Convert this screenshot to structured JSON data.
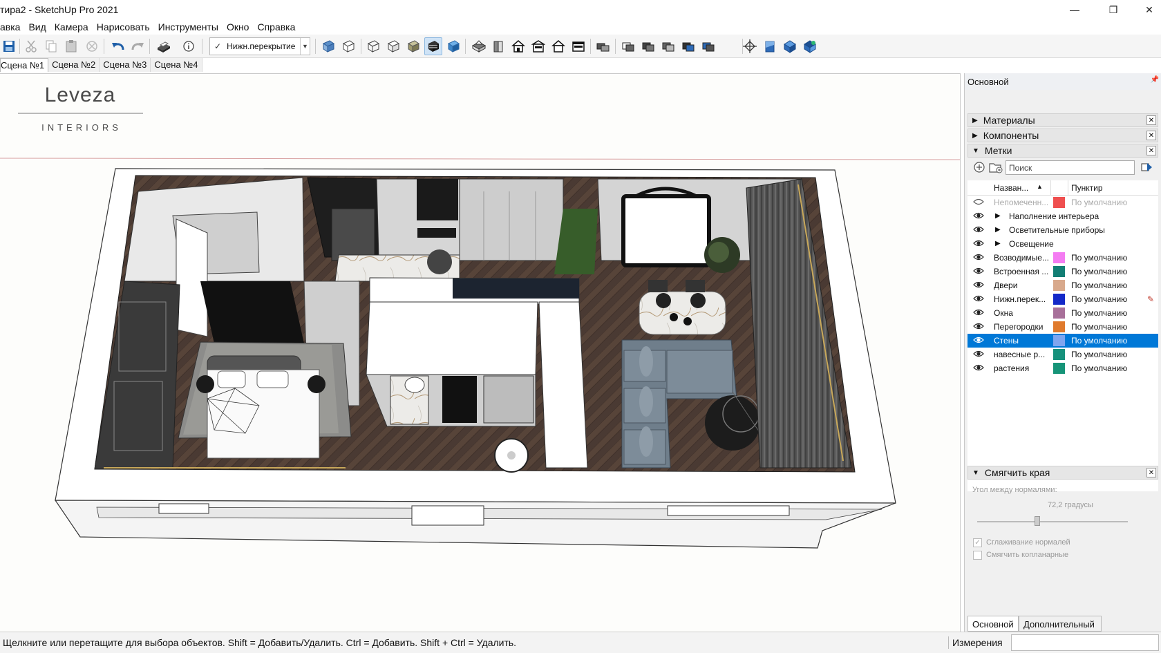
{
  "window": {
    "title": "тира2 - SketchUp Pro 2021",
    "minimize": "—",
    "maximize": "❐",
    "close": "✕"
  },
  "menu": [
    "авка",
    "Вид",
    "Камера",
    "Нарисовать",
    "Инструменты",
    "Окно",
    "Справка"
  ],
  "toolbar": {
    "tag_dropdown_value": "Нижн.перекрытие",
    "icons": [
      "save-icon",
      "cut-icon",
      "copy-icon",
      "paste-icon",
      "erase-icon",
      "undo-icon",
      "redo-icon",
      "print-icon",
      "model-info-icon",
      "xray-icon",
      "back-edges-icon",
      "wireframe-icon",
      "hidden-line-icon",
      "shaded-icon",
      "shaded-textures-icon",
      "monochrome-icon",
      "iso-view-icon",
      "top-view-icon",
      "front-view-icon",
      "right-view-icon",
      "back-view-icon",
      "left-view-icon",
      "bottom-view-icon",
      "section-plane-icon",
      "section-cut-icon",
      "display-section-planes-icon",
      "display-section-cuts-icon",
      "display-section-fill-icon",
      "add-location-icon",
      "toggle-terrain-icon",
      "warehouse-icon",
      "extension-warehouse-icon",
      "position-camera-icon"
    ]
  },
  "scenes": [
    "Сцена №1",
    "Сцена №2",
    "Сцена №3",
    "Сцена №4"
  ],
  "viewport": {
    "logo_main": "Leveza",
    "logo_sub": "INTERIORS"
  },
  "tray": {
    "title": "Основной",
    "panels": {
      "materials": "Материалы",
      "components": "Компоненты",
      "tags": "Метки"
    },
    "search_placeholder": "Поиск",
    "columns": {
      "name": "Назван...",
      "dash": "Пунктир"
    },
    "tags": [
      {
        "name": "Непомеченн...",
        "color": "#ef4f4f",
        "dash": "По умолчанию",
        "visible": "hidden-eye",
        "dim": true
      },
      {
        "name": "Наполнение интерьера",
        "folder": true
      },
      {
        "name": "Осветительные приборы",
        "folder": true
      },
      {
        "name": "Освещение",
        "folder": true
      },
      {
        "name": "Возводимые...",
        "color": "#f47cf2",
        "dash": "По умолчанию"
      },
      {
        "name": "Встроенная ...",
        "color": "#127e74",
        "dash": "По умолчанию"
      },
      {
        "name": "Двери",
        "color": "#d8a98c",
        "dash": "По умолчанию"
      },
      {
        "name": "Нижн.перек...",
        "color": "#1429c8",
        "dash": "По умолчанию",
        "active": true
      },
      {
        "name": "Окна",
        "color": "#a8709a",
        "dash": "По умолчанию"
      },
      {
        "name": "Перегородки",
        "color": "#e07a2c",
        "dash": "По умолчанию"
      },
      {
        "name": "Стены",
        "color": "#7fa5ef",
        "dash": "По умолчанию",
        "selected": true
      },
      {
        "name": "навесные р...",
        "color": "#16917c",
        "dash": "По умолчанию"
      },
      {
        "name": "растения",
        "color": "#169478",
        "dash": "По умолчанию"
      }
    ],
    "soften": {
      "title": "Смягчить края",
      "angle_label": "Угол между нормалями:",
      "angle_value": "72,2 градусы",
      "angle_degrees": 72.2,
      "smooth_normals": "Сглаживание нормалей",
      "soften_coplanar": "Смягчить копланарные"
    },
    "tabs": [
      "Основной",
      "Дополнительный"
    ]
  },
  "status": {
    "message": "Щелкните или перетащите для выбора объектов. Shift = Добавить/Удалить. Ctrl = Добавить. Shift + Ctrl = Удалить.",
    "measurements_label": "Измерения"
  }
}
